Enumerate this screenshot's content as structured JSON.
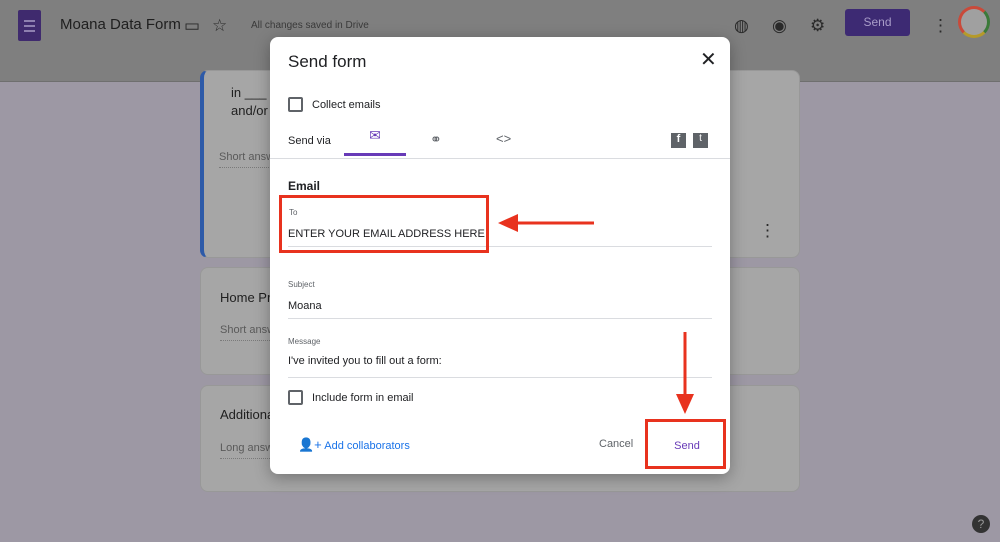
{
  "header": {
    "title": "Moana Data Form",
    "saved": "All changes saved in Drive",
    "send_label": "Send"
  },
  "cards": [
    {
      "line1": "in ___ c",
      "line2": "and/or",
      "answer": "Short answ"
    },
    {
      "title": "Home Pra",
      "answer": "Short answ"
    },
    {
      "title": "Additiona",
      "answer": "Long answ"
    }
  ],
  "dialog": {
    "title": "Send form",
    "collect_emails": "Collect emails",
    "send_via": "Send via",
    "section": "Email",
    "to_label": "To",
    "to_value": "ENTER YOUR EMAIL ADDRESS HERE",
    "subject_label": "Subject",
    "subject_value": "Moana",
    "message_label": "Message",
    "message_value": "I've invited you to fill out a form:",
    "include_form": "Include form in email",
    "add_collaborators": "Add collaborators",
    "cancel": "Cancel",
    "send": "Send"
  },
  "colors": {
    "accent": "#673ab7",
    "annotation": "#e8321e"
  }
}
